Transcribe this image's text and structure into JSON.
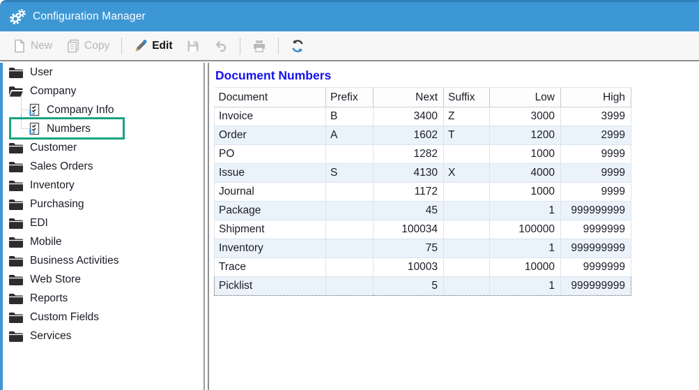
{
  "window": {
    "title": "Configuration Manager"
  },
  "toolbar": {
    "new_label": "New",
    "copy_label": "Copy",
    "edit_label": "Edit",
    "icons": [
      "new-document-icon",
      "copy-icon",
      "pencil-icon",
      "save-icon",
      "undo-icon",
      "print-icon",
      "refresh-icon"
    ],
    "accent_color": "#2f86cc"
  },
  "sidebar": {
    "highlight_color": "#18a383",
    "items": [
      {
        "label": "User",
        "type": "folder"
      },
      {
        "label": "Company",
        "type": "folder-open"
      },
      {
        "label": "Company Info",
        "type": "child"
      },
      {
        "label": "Numbers",
        "type": "child",
        "highlighted": true
      },
      {
        "label": "Customer",
        "type": "folder"
      },
      {
        "label": "Sales Orders",
        "type": "folder"
      },
      {
        "label": "Inventory",
        "type": "folder"
      },
      {
        "label": "Purchasing",
        "type": "folder"
      },
      {
        "label": "EDI",
        "type": "folder"
      },
      {
        "label": "Mobile",
        "type": "folder"
      },
      {
        "label": "Business Activities",
        "type": "folder"
      },
      {
        "label": "Web Store",
        "type": "folder"
      },
      {
        "label": "Reports",
        "type": "folder"
      },
      {
        "label": "Custom Fields",
        "type": "folder"
      },
      {
        "label": "Services",
        "type": "folder"
      }
    ]
  },
  "main": {
    "title": "Document Numbers",
    "title_color": "#1512ee",
    "table": {
      "columns": [
        {
          "label": "Document",
          "align": "left"
        },
        {
          "label": "Prefix",
          "align": "left"
        },
        {
          "label": "Next",
          "align": "right"
        },
        {
          "label": "Suffix",
          "align": "left"
        },
        {
          "label": "Low",
          "align": "right"
        },
        {
          "label": "High",
          "align": "right"
        }
      ],
      "rows": [
        [
          "Invoice",
          "B",
          "3400",
          "Z",
          "3000",
          "3999"
        ],
        [
          "Order",
          "A",
          "1602",
          "T",
          "1200",
          "2999"
        ],
        [
          "PO",
          "",
          "1282",
          "",
          "1000",
          "9999"
        ],
        [
          "Issue",
          "S",
          "4130",
          "X",
          "4000",
          "9999"
        ],
        [
          "Journal",
          "",
          "1172",
          "",
          "1000",
          "9999"
        ],
        [
          "Package",
          "",
          "45",
          "",
          "1",
          "999999999"
        ],
        [
          "Shipment",
          "",
          "100034",
          "",
          "100000",
          "9999999"
        ],
        [
          "Inventory",
          "",
          "75",
          "",
          "1",
          "999999999"
        ],
        [
          "Trace",
          "",
          "10003",
          "",
          "10000",
          "9999999"
        ],
        [
          "Picklist",
          "",
          "5",
          "",
          "1",
          "999999999"
        ]
      ],
      "focused_row_index": 9
    }
  }
}
